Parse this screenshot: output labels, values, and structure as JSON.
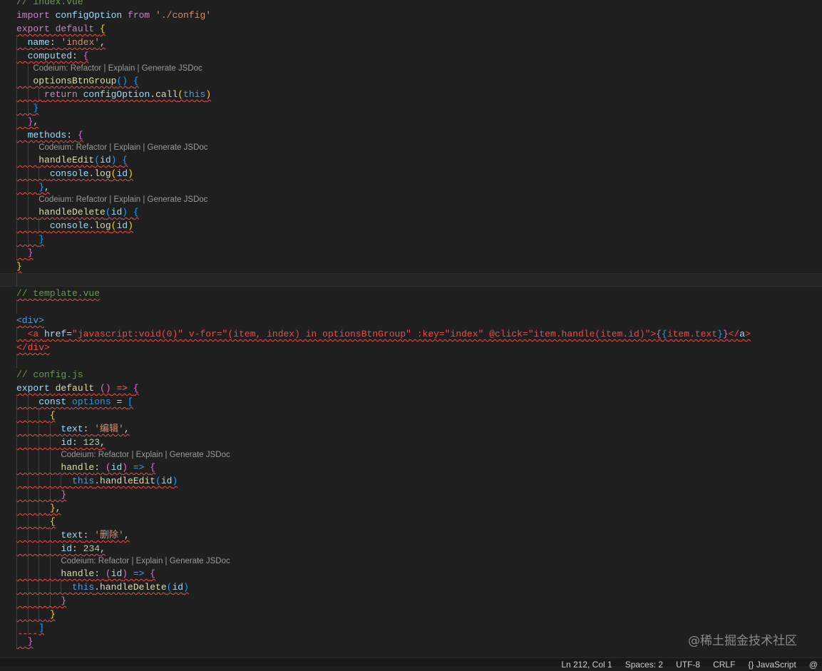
{
  "lens_text": "Codeium: Refactor | Explain | Generate JSDoc",
  "lines": [
    {
      "t": [
        [
          "c",
          "// index.vue"
        ]
      ]
    },
    {
      "t": [
        [
          "k",
          "import "
        ],
        [
          "v",
          "configOption "
        ],
        [
          "k",
          "from "
        ],
        [
          "s",
          "'./config'"
        ]
      ]
    },
    {
      "sq": 1,
      "t": [
        [
          "k",
          "export default "
        ],
        [
          "b1",
          "{"
        ]
      ]
    },
    {
      "sq": 1,
      "t": [
        [
          "p",
          "  "
        ],
        [
          "v",
          "name"
        ],
        [
          "p",
          ": "
        ],
        [
          "s",
          "'index'"
        ],
        [
          "p",
          ","
        ]
      ]
    },
    {
      "sq": 1,
      "t": [
        [
          "p",
          "  "
        ],
        [
          "v",
          "computed"
        ],
        [
          "p",
          ": "
        ],
        [
          "b2",
          "{"
        ]
      ]
    },
    {
      "lens": 1,
      "ind": "   "
    },
    {
      "sq": 1,
      "t": [
        [
          "p",
          "   "
        ],
        [
          "f",
          "optionsBtnGroup"
        ],
        [
          "b3",
          "()"
        ],
        [
          "p",
          " "
        ],
        [
          "b3",
          "{"
        ]
      ]
    },
    {
      "sq": 1,
      "t": [
        [
          "p",
          "     "
        ],
        [
          "k",
          "return "
        ],
        [
          "v",
          "configOption"
        ],
        [
          "p",
          "."
        ],
        [
          "f",
          "call"
        ],
        [
          "b1",
          "("
        ],
        [
          "t",
          "this"
        ],
        [
          "b1",
          ")"
        ]
      ]
    },
    {
      "sq": 1,
      "t": [
        [
          "p",
          "   "
        ],
        [
          "b3",
          "}"
        ]
      ]
    },
    {
      "sq": 1,
      "t": [
        [
          "p",
          "  "
        ],
        [
          "b2",
          "}"
        ],
        [
          "p",
          ","
        ]
      ]
    },
    {
      "sq": 1,
      "t": [
        [
          "p",
          "  "
        ],
        [
          "v",
          "methods"
        ],
        [
          "p",
          ": "
        ],
        [
          "b2",
          "{"
        ]
      ]
    },
    {
      "lens": 1,
      "ind": "    "
    },
    {
      "sq": 1,
      "t": [
        [
          "p",
          "    "
        ],
        [
          "f",
          "handleEdit"
        ],
        [
          "b3",
          "("
        ],
        [
          "v",
          "id"
        ],
        [
          "b3",
          ")"
        ],
        [
          "p",
          " "
        ],
        [
          "b3",
          "{"
        ]
      ]
    },
    {
      "sq": 1,
      "t": [
        [
          "p",
          "      "
        ],
        [
          "v",
          "console"
        ],
        [
          "p",
          "."
        ],
        [
          "f",
          "log"
        ],
        [
          "b1",
          "("
        ],
        [
          "v",
          "id"
        ],
        [
          "b1",
          ")"
        ]
      ]
    },
    {
      "sq": 1,
      "t": [
        [
          "p",
          "    "
        ],
        [
          "b3",
          "}"
        ],
        [
          "p",
          ","
        ]
      ]
    },
    {
      "lens": 1,
      "ind": "    "
    },
    {
      "sq": 1,
      "t": [
        [
          "p",
          "    "
        ],
        [
          "f",
          "handleDelete"
        ],
        [
          "b3",
          "("
        ],
        [
          "v",
          "id"
        ],
        [
          "b3",
          ")"
        ],
        [
          "p",
          " "
        ],
        [
          "b3",
          "{"
        ]
      ]
    },
    {
      "sq": 1,
      "t": [
        [
          "p",
          "      "
        ],
        [
          "v",
          "console"
        ],
        [
          "p",
          "."
        ],
        [
          "f",
          "log"
        ],
        [
          "b1",
          "("
        ],
        [
          "v",
          "id"
        ],
        [
          "b1",
          ")"
        ]
      ]
    },
    {
      "sq": 1,
      "t": [
        [
          "p",
          "    "
        ],
        [
          "b3",
          "}"
        ]
      ]
    },
    {
      "sq": 1,
      "t": [
        [
          "p",
          "  "
        ],
        [
          "b2",
          "}"
        ]
      ]
    },
    {
      "sq": 1,
      "t": [
        [
          "b1",
          "}"
        ]
      ]
    },
    {
      "cur": 1,
      "t": [
        [
          "p",
          " "
        ]
      ]
    },
    {
      "sq": 1,
      "t": [
        [
          "c",
          "// template.vue"
        ]
      ]
    },
    {
      "t": [
        [
          "p",
          " "
        ]
      ]
    },
    {
      "sq": 1,
      "t": [
        [
          "t",
          "<div>"
        ]
      ]
    },
    {
      "sq": 1,
      "t": [
        [
          "p",
          "  "
        ],
        [
          "r",
          "<a "
        ],
        [
          "v",
          "href"
        ],
        [
          "p",
          "="
        ],
        [
          "r",
          "\"javascript:void(0)\" v-for=\"(item, index) in optionsBtnGroup\" :key=\"index\" @click=\"item.handle(item.id)\">"
        ],
        [
          "b2",
          "{"
        ],
        [
          "b3",
          "{"
        ],
        [
          "r",
          "item.text"
        ],
        [
          "b3",
          "}"
        ],
        [
          "b2",
          "}"
        ],
        [
          "r",
          "</"
        ],
        [
          "v",
          "a"
        ],
        [
          "r",
          ">"
        ]
      ]
    },
    {
      "sq": 1,
      "t": [
        [
          "r",
          "</div>"
        ]
      ]
    },
    {
      "t": [
        [
          "p",
          " "
        ]
      ]
    },
    {
      "t": [
        [
          "c",
          "// config.js"
        ]
      ]
    },
    {
      "sq": 1,
      "t": [
        [
          "v",
          "export "
        ],
        [
          "f",
          "default "
        ],
        [
          "b2",
          "()"
        ],
        [
          "a",
          " => "
        ],
        [
          "b2",
          "{"
        ]
      ]
    },
    {
      "sq": 1,
      "t": [
        [
          "p",
          "    "
        ],
        [
          "v",
          "const "
        ],
        [
          "o",
          "options"
        ],
        [
          "p",
          " = "
        ],
        [
          "b3",
          "["
        ]
      ]
    },
    {
      "sq": 1,
      "t": [
        [
          "p",
          "      "
        ],
        [
          "b1",
          "{"
        ]
      ]
    },
    {
      "sq": 1,
      "t": [
        [
          "p",
          "        "
        ],
        [
          "v",
          "text"
        ],
        [
          "p",
          ": "
        ],
        [
          "s",
          "'编辑'"
        ],
        [
          "p",
          ","
        ]
      ]
    },
    {
      "sq": 1,
      "t": [
        [
          "p",
          "        "
        ],
        [
          "v",
          "id"
        ],
        [
          "p",
          ": "
        ],
        [
          "n",
          "123"
        ],
        [
          "p",
          ","
        ]
      ]
    },
    {
      "lens": 1,
      "ind": "        "
    },
    {
      "sq": 1,
      "t": [
        [
          "p",
          "        "
        ],
        [
          "f",
          "handle"
        ],
        [
          "p",
          ": "
        ],
        [
          "b2",
          "("
        ],
        [
          "v",
          "id"
        ],
        [
          "b2",
          ")"
        ],
        [
          "t",
          " => "
        ],
        [
          "b2",
          "{"
        ]
      ]
    },
    {
      "sq": 1,
      "t": [
        [
          "p",
          "          "
        ],
        [
          "t",
          "this"
        ],
        [
          "p",
          "."
        ],
        [
          "f",
          "handleEdit"
        ],
        [
          "b3",
          "("
        ],
        [
          "v",
          "id"
        ],
        [
          "b3",
          ")"
        ]
      ]
    },
    {
      "sq": 1,
      "t": [
        [
          "p",
          "        "
        ],
        [
          "b2",
          "}"
        ]
      ]
    },
    {
      "sq": 1,
      "t": [
        [
          "p",
          "      "
        ],
        [
          "b1",
          "}"
        ],
        [
          "p",
          ","
        ]
      ]
    },
    {
      "sq": 1,
      "t": [
        [
          "p",
          "      "
        ],
        [
          "b1",
          "{"
        ]
      ]
    },
    {
      "sq": 1,
      "t": [
        [
          "p",
          "        "
        ],
        [
          "v",
          "text"
        ],
        [
          "p",
          ": "
        ],
        [
          "s",
          "'删除'"
        ],
        [
          "p",
          ","
        ]
      ]
    },
    {
      "sq": 1,
      "t": [
        [
          "p",
          "        "
        ],
        [
          "v",
          "id"
        ],
        [
          "p",
          ": "
        ],
        [
          "n",
          "234"
        ],
        [
          "p",
          ","
        ]
      ]
    },
    {
      "lens": 1,
      "ind": "        "
    },
    {
      "sq": 1,
      "t": [
        [
          "p",
          "        "
        ],
        [
          "f",
          "handle"
        ],
        [
          "p",
          ": "
        ],
        [
          "b2",
          "("
        ],
        [
          "v",
          "id"
        ],
        [
          "b2",
          ")"
        ],
        [
          "t",
          " => "
        ],
        [
          "b2",
          "{"
        ]
      ]
    },
    {
      "sq": 1,
      "t": [
        [
          "p",
          "          "
        ],
        [
          "t",
          "this"
        ],
        [
          "p",
          "."
        ],
        [
          "f",
          "handleDelete"
        ],
        [
          "b3",
          "("
        ],
        [
          "v",
          "id"
        ],
        [
          "b3",
          ")"
        ]
      ]
    },
    {
      "sq": 1,
      "t": [
        [
          "p",
          "        "
        ],
        [
          "b2",
          "}"
        ]
      ]
    },
    {
      "sq": 1,
      "t": [
        [
          "p",
          "      "
        ],
        [
          "b1",
          "}"
        ]
      ]
    },
    {
      "sq": 1,
      "t": [
        [
          "p",
          "    "
        ],
        [
          "b3",
          "]"
        ]
      ]
    },
    {
      "sq": 1,
      "t": [
        [
          "p",
          "  "
        ],
        [
          "b2",
          "}"
        ]
      ]
    }
  ],
  "status": {
    "position": "Ln 212, Col 1",
    "spaces": "Spaces: 2",
    "encoding": "UTF-8",
    "eol": "CRLF",
    "language_icon": "{}",
    "language": "JavaScript",
    "notifications_icon": "@"
  },
  "watermark": "@稀土掘金技术社区"
}
